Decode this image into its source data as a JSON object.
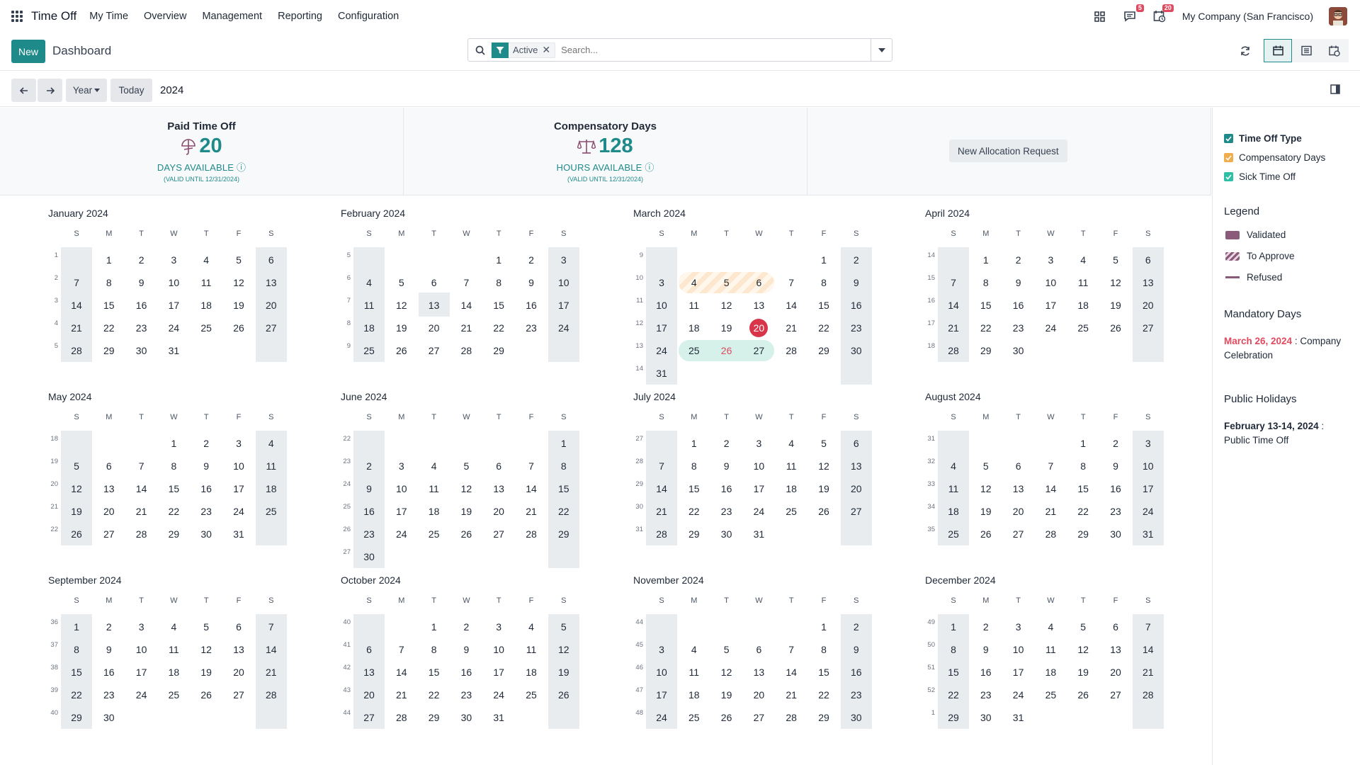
{
  "app": {
    "name": "Time Off",
    "menu": [
      "My Time",
      "Overview",
      "Management",
      "Reporting",
      "Configuration"
    ],
    "messages_badge": "5",
    "activities_badge": "20",
    "company": "My Company (San Francisco)"
  },
  "control": {
    "new_label": "New",
    "breadcrumb": "Dashboard",
    "facet_label": "Active",
    "search_placeholder": "Search..."
  },
  "nav": {
    "scale_label": "Year",
    "today_label": "Today",
    "current_year": "2024"
  },
  "summary": [
    {
      "title": "Paid Time Off",
      "value": "20",
      "unit": "DAYS AVAILABLE",
      "valid": "(VALID UNTIL 12/31/2024)"
    },
    {
      "title": "Compensatory Days",
      "value": "128",
      "unit": "HOURS AVAILABLE",
      "valid": "(VALID UNTIL 12/31/2024)"
    }
  ],
  "allocation_button": "New Allocation Request",
  "sidebar": {
    "filters": [
      {
        "label": "Time Off Type",
        "color": "#1f8a8a",
        "bold": true
      },
      {
        "label": "Compensatory Days",
        "color": "#f0ad4e",
        "bold": false
      },
      {
        "label": "Sick Time Off",
        "color": "#2ebfa5",
        "bold": false
      }
    ],
    "legend_title": "Legend",
    "legend": [
      {
        "label": "Validated",
        "kind": "validated"
      },
      {
        "label": "To Approve",
        "kind": "approve"
      },
      {
        "label": "Refused",
        "kind": "refused"
      }
    ],
    "mandatory_title": "Mandatory Days",
    "mandatory_date": "March 26, 2024",
    "mandatory_text": ": Company Celebration",
    "public_title": "Public Holidays",
    "public_date": "February 13-14, 2024",
    "public_colon": ":",
    "public_text": "Public Time Off"
  },
  "calendar": {
    "weekday_headers": [
      "S",
      "M",
      "T",
      "W",
      "T",
      "F",
      "S"
    ],
    "months": [
      {
        "name": "January 2024",
        "start": 1,
        "days": 31,
        "weeks": [
          "1",
          "2",
          "3",
          "4",
          "5"
        ]
      },
      {
        "name": "February 2024",
        "start": 4,
        "days": 29,
        "weeks": [
          "5",
          "6",
          "7",
          "8",
          "9"
        ]
      },
      {
        "name": "March 2024",
        "start": 5,
        "days": 31,
        "weeks": [
          "9",
          "10",
          "11",
          "12",
          "13",
          "14"
        ]
      },
      {
        "name": "April 2024",
        "start": 1,
        "days": 30,
        "weeks": [
          "14",
          "15",
          "16",
          "17",
          "18"
        ]
      },
      {
        "name": "May 2024",
        "start": 3,
        "days": 31,
        "weeks": [
          "18",
          "19",
          "20",
          "21",
          "22"
        ]
      },
      {
        "name": "June 2024",
        "start": 6,
        "days": 30,
        "weeks": [
          "22",
          "23",
          "24",
          "25",
          "26",
          "27"
        ]
      },
      {
        "name": "July 2024",
        "start": 1,
        "days": 31,
        "weeks": [
          "27",
          "28",
          "29",
          "30",
          "31"
        ]
      },
      {
        "name": "August 2024",
        "start": 4,
        "days": 31,
        "weeks": [
          "31",
          "32",
          "33",
          "34",
          "35"
        ]
      },
      {
        "name": "September 2024",
        "start": 0,
        "days": 30,
        "weeks": [
          "36",
          "37",
          "38",
          "39",
          "40"
        ]
      },
      {
        "name": "October 2024",
        "start": 2,
        "days": 31,
        "weeks": [
          "40",
          "41",
          "42",
          "43",
          "44"
        ]
      },
      {
        "name": "November 2024",
        "start": 5,
        "days": 30,
        "weeks": [
          "44",
          "45",
          "46",
          "47",
          "48"
        ]
      },
      {
        "name": "December 2024",
        "start": 0,
        "days": 31,
        "weeks": [
          "49",
          "50",
          "51",
          "52",
          "1"
        ]
      }
    ],
    "to_approve": {
      "month": "March 2024",
      "days": [
        4,
        5,
        6
      ]
    },
    "mandatory_days": {
      "month": "March 2024",
      "days": [
        25,
        26,
        27
      ],
      "highlight_day": 26
    },
    "public_holiday": {
      "month": "February 2024",
      "day": 13
    },
    "today": {
      "month": "March 2024",
      "day": 20
    },
    "colors": {
      "accent": "#1f8a8a",
      "today": "#d9354a",
      "weekend": "#e9ecef",
      "approve": "#fde7cf",
      "mandatory": "#d6f0ea",
      "mandatory_text": "#e04a5f"
    }
  }
}
